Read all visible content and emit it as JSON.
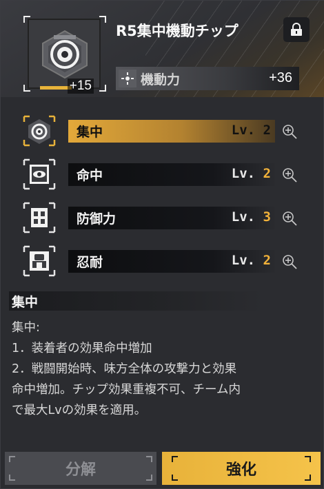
{
  "chip": {
    "title": "R5集中機動チップ",
    "enhance_level": "+15",
    "enhance_progress": 0.45,
    "icon": "target-chip-icon"
  },
  "main_stat": {
    "icon": "mobility-icon",
    "name": "機動力",
    "value": "+36"
  },
  "lock": {
    "icon": "lock-icon"
  },
  "skills": [
    {
      "name": "集中",
      "lv_prefix": "Lv.",
      "lv": "2",
      "icon": "focus-eye-icon",
      "active": true
    },
    {
      "name": "命中",
      "lv_prefix": "Lv.",
      "lv": "2",
      "icon": "accuracy-eye-icon",
      "active": false
    },
    {
      "name": "防御力",
      "lv_prefix": "Lv.",
      "lv": "3",
      "icon": "defense-block-icon",
      "active": false
    },
    {
      "name": "忍耐",
      "lv_prefix": "Lv.",
      "lv": "2",
      "icon": "endurance-robot-icon",
      "active": false
    }
  ],
  "description": {
    "heading": "集中",
    "lines": [
      "集中:",
      "1．装着者の効果命中増加",
      "2．戦闘開始時、味方全体の攻撃力と効果",
      "命中増加。チップ効果重複不可、チーム内",
      "で最大Lvの効果を適用。"
    ]
  },
  "buttons": {
    "decompose": "分解",
    "enhance": "強化"
  },
  "colors": {
    "accent": "#e8b23a",
    "panel": "#2b2c30",
    "level_highlight": "#f2b23a"
  }
}
